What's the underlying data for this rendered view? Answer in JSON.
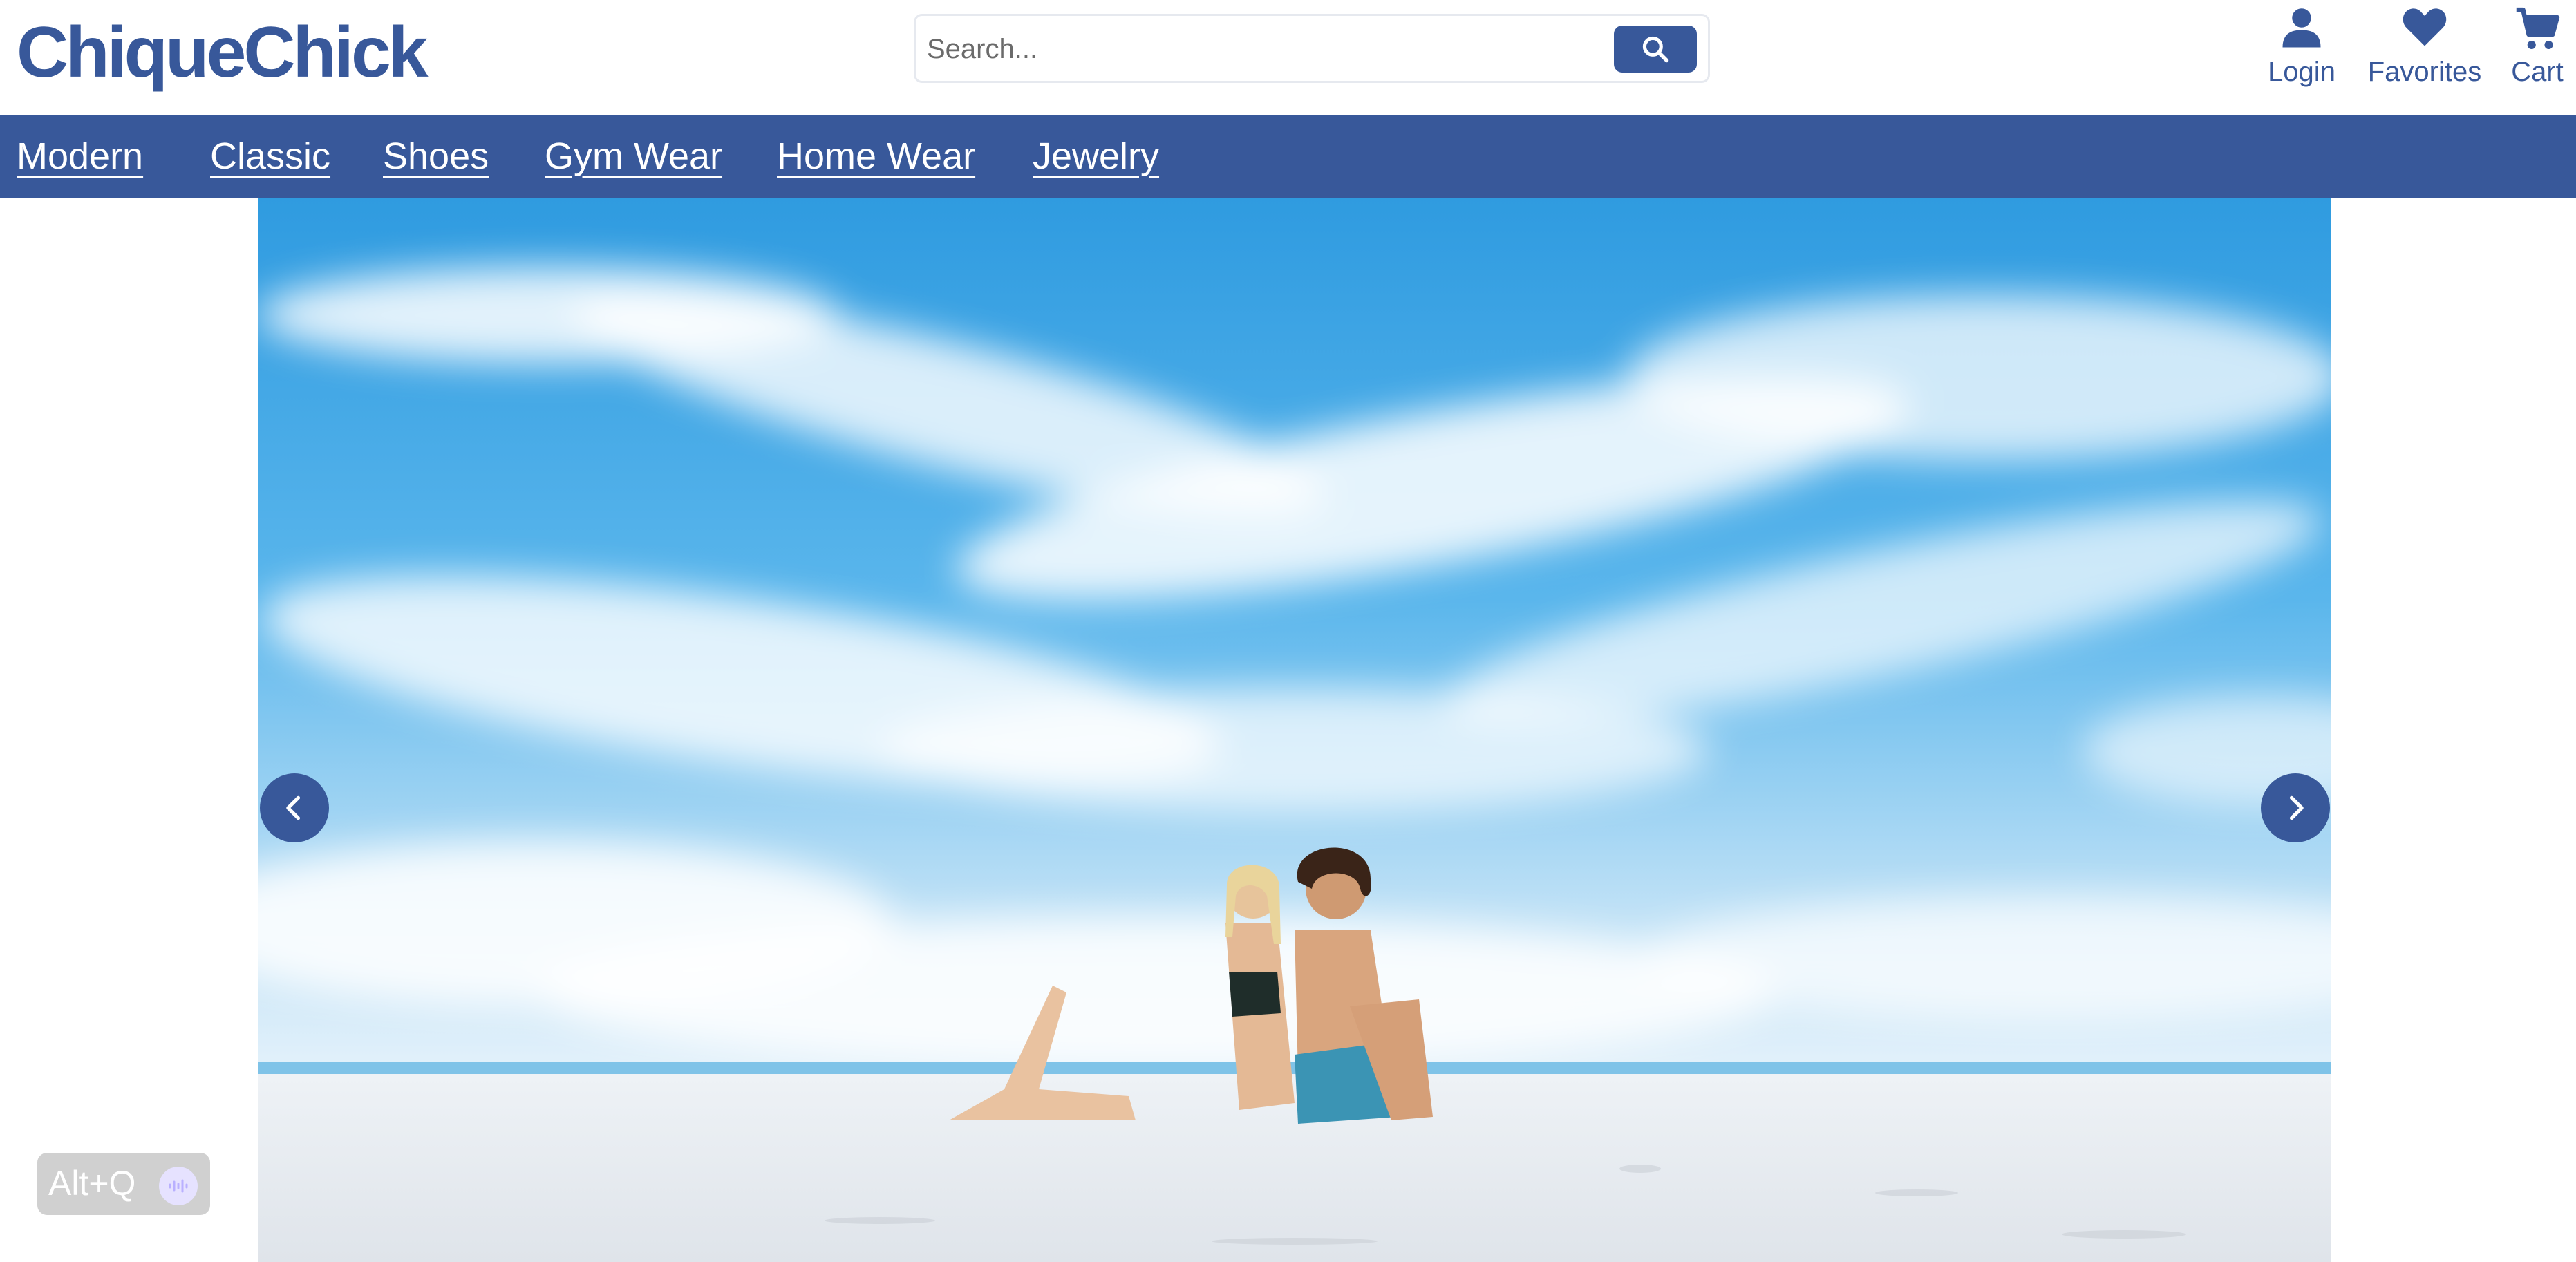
{
  "header": {
    "logo": "ChiqueChick",
    "search": {
      "placeholder": "Search...",
      "value": ""
    },
    "actions": [
      {
        "label": "Login",
        "icon": "user-icon"
      },
      {
        "label": "Favorites",
        "icon": "heart-icon"
      },
      {
        "label": "Cart",
        "icon": "cart-icon"
      }
    ]
  },
  "nav": {
    "items": [
      {
        "label": "Modern"
      },
      {
        "label": "Classic"
      },
      {
        "label": "Shoes"
      },
      {
        "label": "Gym Wear"
      },
      {
        "label": "Home Wear"
      },
      {
        "label": "Jewelry"
      }
    ]
  },
  "hero": {
    "image": "beach-couple-photo",
    "prev_icon": "chevron-left-icon",
    "next_icon": "chevron-right-icon"
  },
  "overlay": {
    "shortcut_label": "Alt+Q",
    "icon": "waveform-icon"
  },
  "colors": {
    "brand": "#38589a",
    "nav_text": "#ffffff",
    "search_border": "#e6e9ef",
    "overlay_bg": "#d0d0d0"
  }
}
